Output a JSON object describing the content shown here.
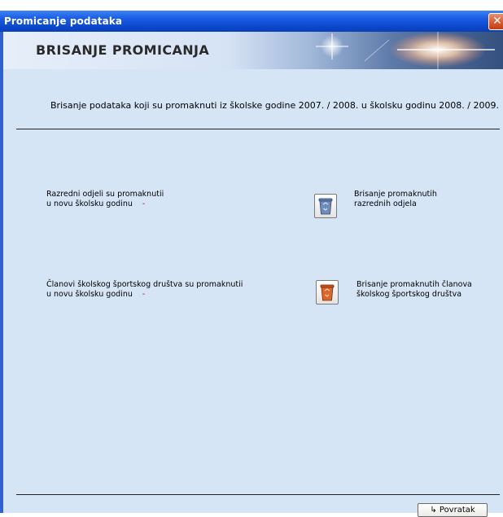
{
  "window": {
    "title": "Promicanje podataka",
    "close_glyph": "✕"
  },
  "banner": {
    "title": "BRISANJE PROMICANJA"
  },
  "description": "Brisanje podataka koji su promaknuti iz školske godine 2007. / 2008. u školsku godinu 2008. / 2009.",
  "sections": {
    "classes": {
      "status_line1": "Razredni odjeli su promaknutii",
      "status_line2": "u novu školsku godinu",
      "status_value": "-",
      "action_line1": "Brisanje promaknutih",
      "action_line2": "razrednih odjela",
      "icon": "recycle-bin-icon",
      "icon_color": "#4f6f9a"
    },
    "sports": {
      "status_line1": "Članovi školskog športskog društva su promaknutii",
      "status_line2": "u novu školsku godinu",
      "status_value": "-",
      "action_line1": "Brisanje promaknutih članova",
      "action_line2": "školskog športskog društva",
      "icon": "recycle-bin-icon",
      "icon_color": "#d2541e"
    }
  },
  "footer": {
    "back_icon": "↳",
    "back_label": "Povratak"
  },
  "colors": {
    "titlebar": "#0a46c9",
    "client_bg": "#d6e5f5",
    "dash": "#dd0000"
  }
}
